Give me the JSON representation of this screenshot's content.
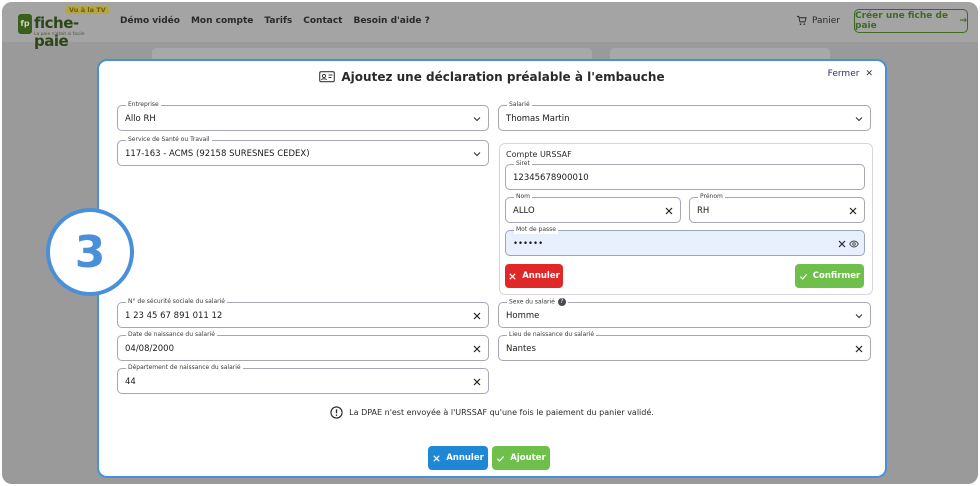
{
  "nav": {
    "logo_badge": "fp",
    "logo_text": "fiche-paie",
    "logo_tv": "Vu à la TV",
    "logo_tagline": "La paie n'était si facile",
    "links": [
      "Démo vidéo",
      "Mon compte",
      "Tarifs",
      "Contact",
      "Besoin d'aide ?"
    ],
    "cart_label": "Panier",
    "create_label": "Créer une fiche de paie"
  },
  "step": "3",
  "modal": {
    "title": "Ajoutez une déclaration préalable à l'embauche",
    "close_label": "Fermer",
    "entreprise": {
      "label": "Entreprise",
      "value": "Allo RH"
    },
    "salarie": {
      "label": "Salarié",
      "value": "Thomas Martin"
    },
    "sante": {
      "label": "Service de Santé ou Travail",
      "value": "117-163 - ACMS (92158 SURESNES CEDEX)"
    },
    "urssaf": {
      "title": "Compte URSSAF",
      "siret": {
        "label": "Siret",
        "value": "12345678900010"
      },
      "nom": {
        "label": "Nom",
        "value": "ALLO"
      },
      "prenom": {
        "label": "Prénom",
        "value": "RH"
      },
      "password": {
        "label": "Mot de passe",
        "value": "••••••"
      },
      "cancel_label": "Annuler",
      "confirm_label": "Confirmer"
    },
    "secu": {
      "label": "N° de sécurité sociale du salarié",
      "value": "1 23 45 67 891 011 12"
    },
    "sexe": {
      "label": "Sexe du salarié",
      "value": "Homme"
    },
    "naissance_date": {
      "label": "Date de naissance du salarié",
      "value": "04/08/2000"
    },
    "naissance_lieu": {
      "label": "Lieu de naissance du salarié",
      "value": "Nantes"
    },
    "departement": {
      "label": "Département de naissance du salarié",
      "value": "44"
    },
    "notice": "La DPAE n'est envoyée à l'URSSAF qu'une fois le paiement du panier validé.",
    "cancel_label": "Annuler",
    "submit_label": "Ajouter"
  },
  "colors": {
    "accent_blue": "#4a90d9",
    "danger": "#e02828",
    "success": "#6ec04b",
    "primary": "#1f88d6"
  }
}
